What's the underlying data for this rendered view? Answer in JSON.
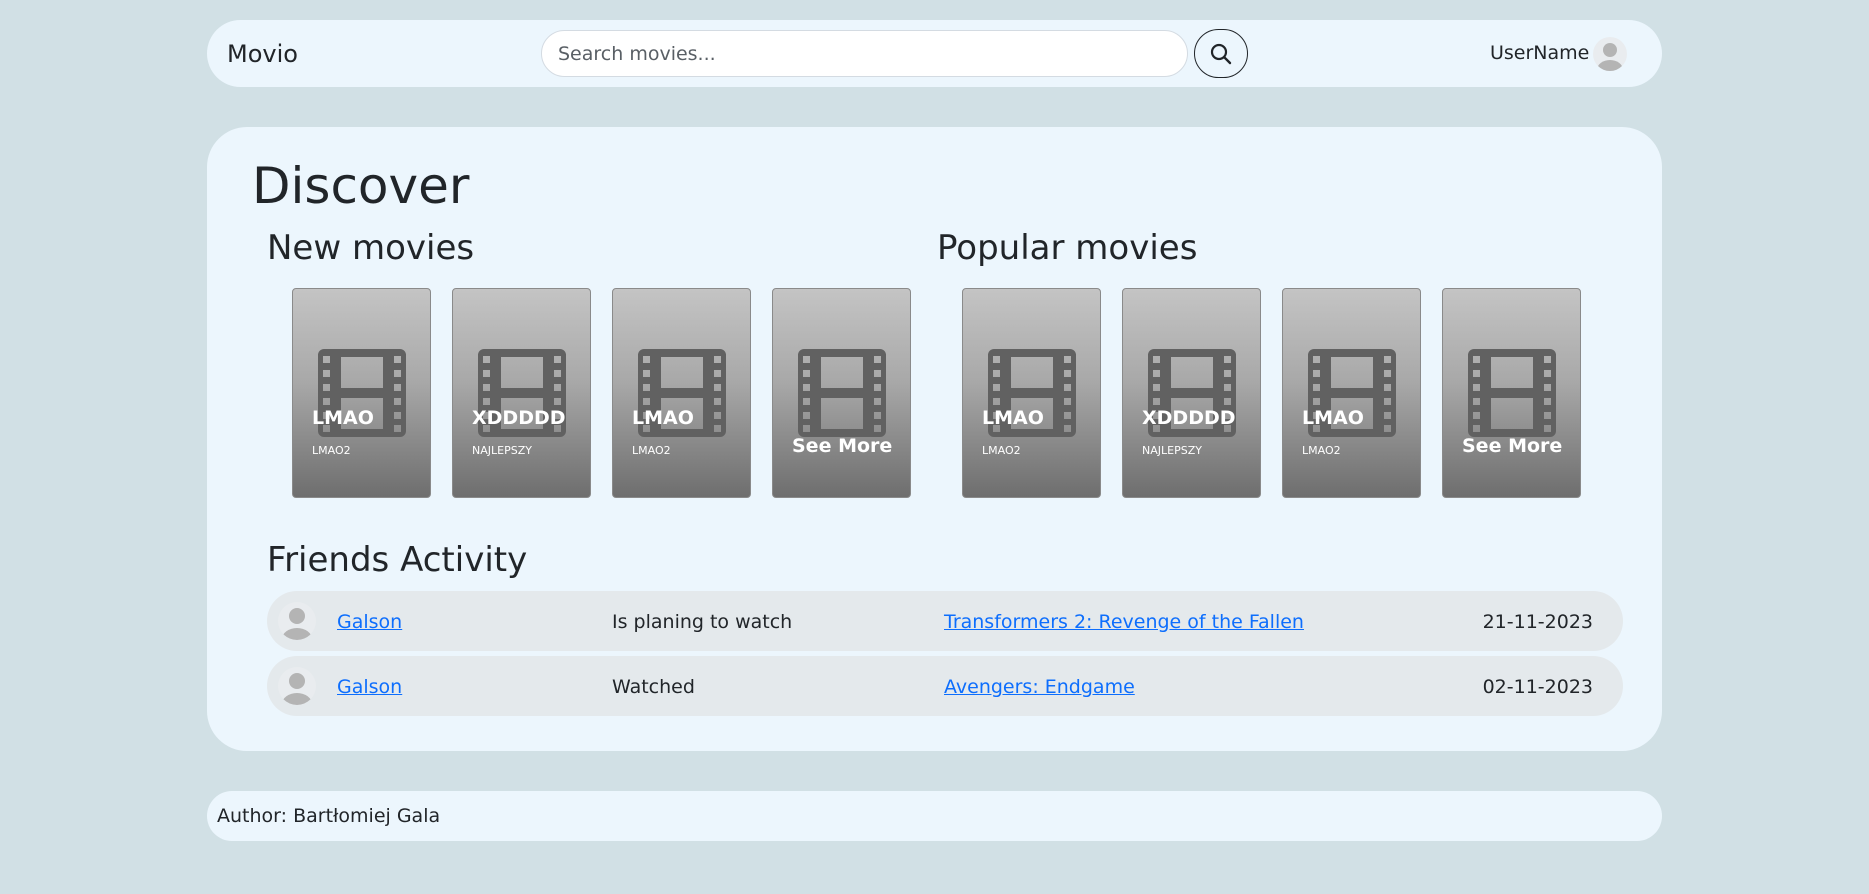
{
  "nav": {
    "brand": "Movio",
    "search_placeholder": "Search movies...",
    "username": "UserName"
  },
  "main": {
    "title": "Discover",
    "new_movies": {
      "heading": "New movies",
      "cards": [
        {
          "title": "LMAO",
          "subtitle": "LMAO2"
        },
        {
          "title": "XDDDDD",
          "subtitle": "NAJLEPSZY"
        },
        {
          "title": "LMAO",
          "subtitle": "LMAO2"
        }
      ],
      "see_more": "See More"
    },
    "popular_movies": {
      "heading": "Popular movies",
      "cards": [
        {
          "title": "LMAO",
          "subtitle": "LMAO2"
        },
        {
          "title": "XDDDDD",
          "subtitle": "NAJLEPSZY"
        },
        {
          "title": "LMAO",
          "subtitle": "LMAO2"
        }
      ],
      "see_more": "See More"
    },
    "friends": {
      "heading": "Friends Activity",
      "rows": [
        {
          "user": "Galson",
          "action": "Is planing to watch",
          "movie": "Transformers 2: Revenge of the Fallen",
          "date": "21-11-2023"
        },
        {
          "user": "Galson",
          "action": "Watched",
          "movie": "Avengers: Endgame",
          "date": "02-11-2023"
        }
      ]
    }
  },
  "footer": {
    "text": "Author: Bartłomiej Gala"
  },
  "icons": {
    "search": "search-icon",
    "avatar": "person-avatar-icon",
    "poster": "film-icon"
  },
  "colors": {
    "background": "#d1e0e5",
    "panel": "#ecf6fd",
    "link": "#0d6efd"
  }
}
